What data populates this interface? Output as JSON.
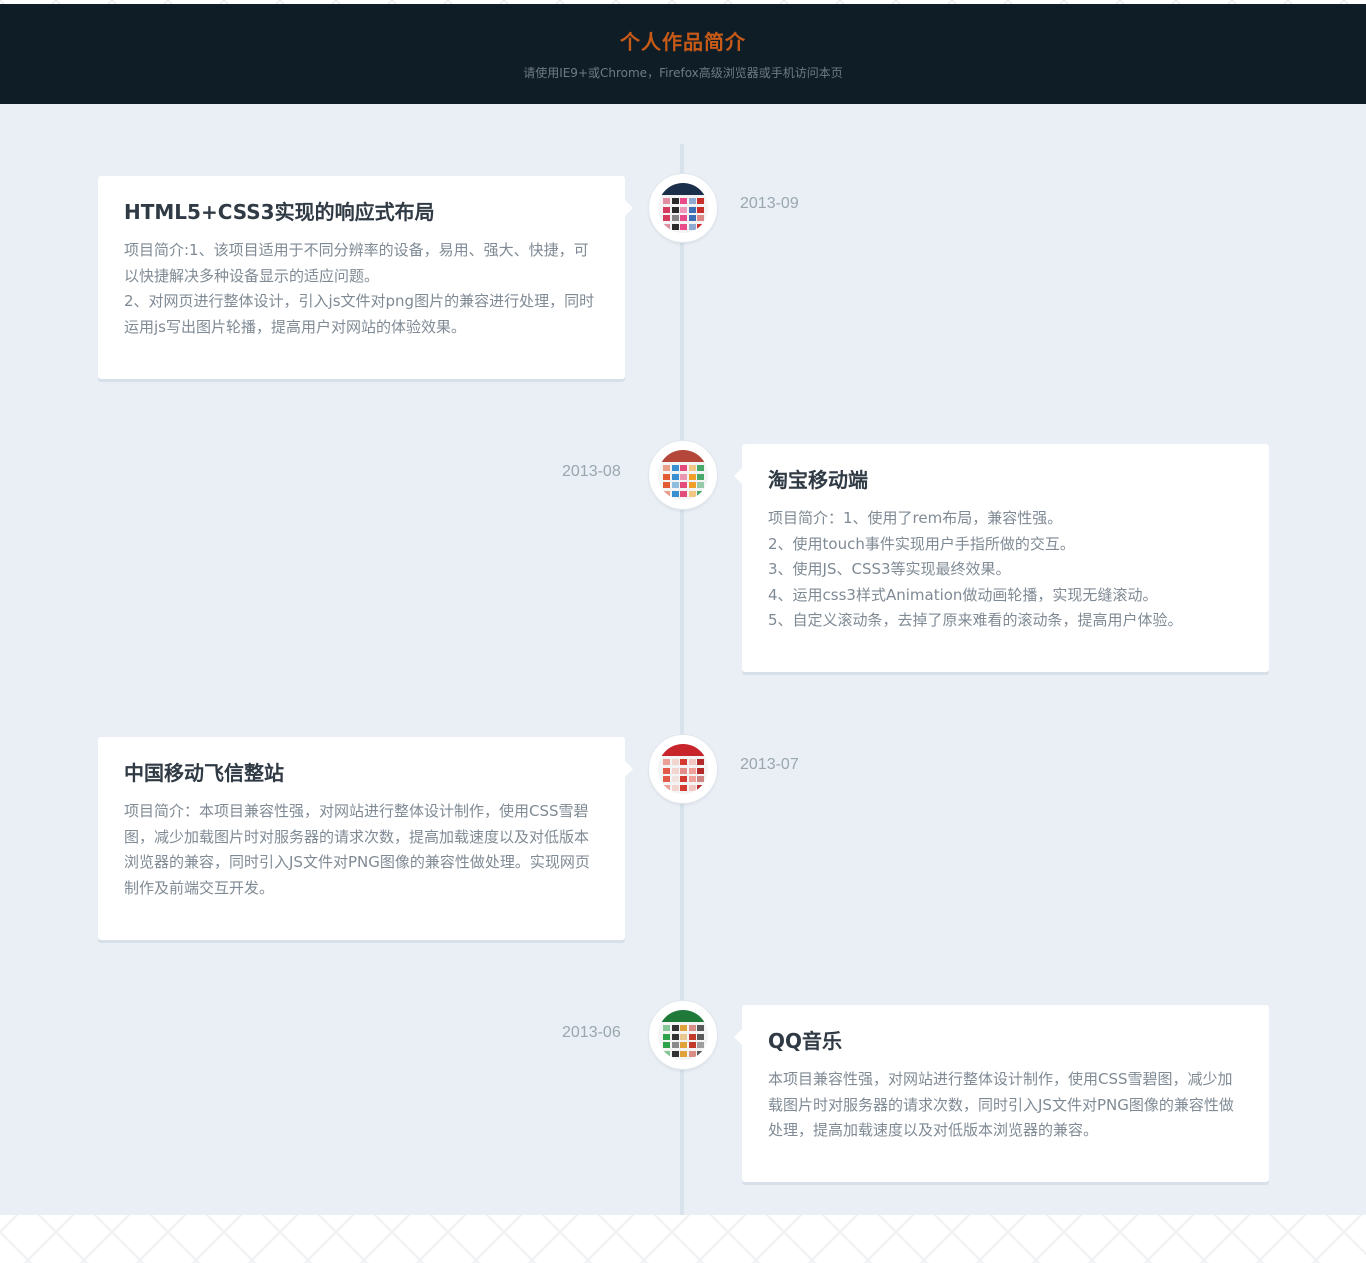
{
  "header": {
    "title": "个人作品简介",
    "subtitle": "请使用IE9+或Chrome，Firefox高级浏览器或手机访问本页"
  },
  "timeline": [
    {
      "date": "2013-09",
      "title": "HTML5+CSS3实现的响应式布局",
      "lines": [
        "项目简介:1、该项目适用于不同分辨率的设备，易用、强大、快捷，可以快捷解决多种设备显示的适应问题。",
        "2、对网页进行整体设计，引入js文件对png图片的兼容进行处理，同时运用js写出图片轮播，提高用户对网站的体验效果。"
      ],
      "thumb_colors": [
        "#1b2f4a",
        "#d43b5c",
        "#2a2a2a",
        "#e94b8a",
        "#3c6fb5",
        "#c9302c"
      ]
    },
    {
      "date": "2013-08",
      "title": "淘宝移动端",
      "lines": [
        "项目简介：1、使用了rem布局，兼容性强。",
        "2、使用touch事件实现用户手指所做的交互。",
        "3、使用JS、CSS3等实现最终效果。",
        "4、运用css3样式Animation做动画轮播，实现无缝滚动。",
        "5、自定义滚动条，去掉了原来难看的滚动条，提高用户体验。"
      ],
      "thumb_colors": [
        "#b5463a",
        "#e15a33",
        "#3a8fd0",
        "#e34b7a",
        "#f0a02a",
        "#4aa86a"
      ]
    },
    {
      "date": "2013-07",
      "title": "中国移动飞信整站",
      "lines": [
        "项目简介：本项目兼容性强，对网站进行整体设计制作，使用CSS雪碧图，减少加载图片时对服务器的请求次数，提高加载速度以及对低版本浏览器的兼容，同时引入JS文件对PNG图像的兼容性做处理。实现网页制作及前端交互开发。"
      ],
      "thumb_colors": [
        "#c8242c",
        "#e25a4a",
        "#f3d5cf",
        "#d43a30",
        "#f1a39b",
        "#b32a2a"
      ]
    },
    {
      "date": "2013-06",
      "title": "QQ音乐",
      "lines": [
        "本项目兼容性强，对网站进行整体设计制作，使用CSS雪碧图，减少加载图片时对服务器的请求次数，同时引入JS文件对PNG图像的兼容性做处理，提高加载速度以及对低版本浏览器的兼容。"
      ],
      "thumb_colors": [
        "#1f7a3a",
        "#2ea24a",
        "#333333",
        "#e0a33a",
        "#c23a2a",
        "#5a5a5a"
      ]
    }
  ]
}
